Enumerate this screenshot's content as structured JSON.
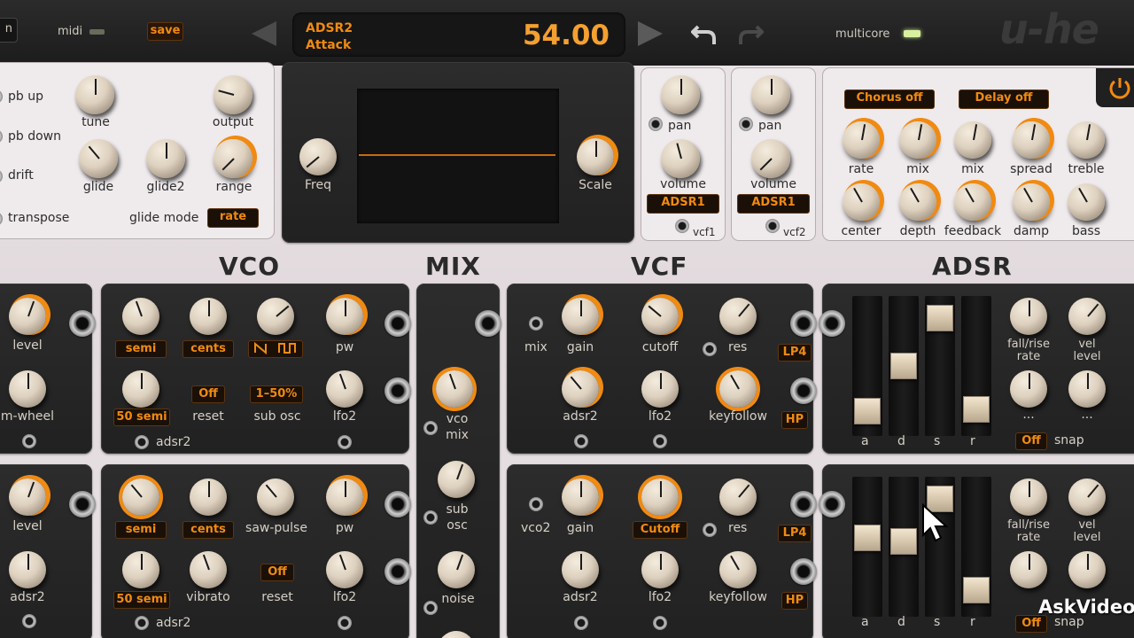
{
  "header": {
    "left_btn": "n",
    "midi": "midi",
    "save": "save",
    "param_name": "ADSR2",
    "param_sub": "Attack",
    "value": "54.00",
    "multicore": "multicore",
    "logo": "u-he",
    "prev_icon": "triangle-left",
    "next_icon": "triangle-right",
    "undo_icon": "undo-arrow",
    "redo_icon": "redo-arrow"
  },
  "colors": {
    "accent": "#f08a12",
    "panel": "#262626",
    "light_panel": "#efeaec",
    "led_green": "#d9f0a0"
  },
  "global": {
    "pb_up": "pb up",
    "pb_down": "pb down",
    "drift": "drift",
    "transpose": "transpose",
    "tune": "tune",
    "output": "output",
    "glide": "glide",
    "glide2": "glide2",
    "range": "range",
    "glide_mode": "glide mode",
    "glide_mode_value": "rate"
  },
  "scope": {
    "freq": "Freq",
    "scale": "Scale"
  },
  "ch1": {
    "pan": "pan",
    "volume": "volume",
    "mod": "ADSR1",
    "vcf": "vcf1"
  },
  "ch2": {
    "pan": "pan",
    "volume": "volume",
    "mod": "ADSR1",
    "vcf": "vcf2"
  },
  "fx": {
    "chorus": "Chorus off",
    "delay": "Delay off",
    "row1": [
      "rate",
      "mix",
      "mix",
      "spread",
      "treble"
    ],
    "row2": [
      "center",
      "depth",
      "feedback",
      "damp",
      "bass"
    ]
  },
  "sections": {
    "vco": "VCO",
    "mix": "MIX",
    "vcf": "VCF",
    "adsr": "ADSR"
  },
  "lfo1": {
    "level": "level",
    "mwheel": "m-wheel"
  },
  "lfo2": {
    "level": "level",
    "adsr2": "adsr2"
  },
  "vco1": {
    "semi": "semi",
    "cents": "cents",
    "wave": "wave-select",
    "pw": "pw",
    "semi_val": "50 semi",
    "reset_val": "Off",
    "reset": "reset",
    "sub_val": "1–50%",
    "sub": "sub osc",
    "lfo2": "lfo2",
    "adsr2": "adsr2"
  },
  "vco2": {
    "semi": "semi",
    "cents": "cents",
    "sawpulse": "saw-pulse",
    "pw": "pw",
    "semi_val": "50 semi",
    "vibrato": "vibrato",
    "reset_val": "Off",
    "reset": "reset",
    "lfo2": "lfo2",
    "adsr2": "adsr2"
  },
  "mix": {
    "vco_mix": "vco mix",
    "sub_osc": "sub osc",
    "noise": "noise"
  },
  "vcf1": {
    "mix": "mix",
    "gain": "gain",
    "cutoff": "cutoff",
    "res": "res",
    "lp": "LP4",
    "adsr2": "adsr2",
    "lfo2": "lfo2",
    "keyfollow": "keyfollow",
    "hp": "HP"
  },
  "vcf2": {
    "vco2": "vco2",
    "gain": "gain",
    "cutoff": "Cutoff",
    "res": "res",
    "lp": "LP4",
    "adsr2": "adsr2",
    "lfo2": "lfo2",
    "keyfollow": "keyfollow",
    "hp": "HP"
  },
  "adsr1": {
    "labels": [
      "a",
      "d",
      "s",
      "r"
    ],
    "levels": [
      0.1,
      0.5,
      0.92,
      0.12
    ],
    "fall": "fall/rise rate",
    "vel": "vel level",
    "dots1": "...",
    "dots2": "...",
    "snap_val": "Off",
    "snap": "snap"
  },
  "adsr2": {
    "labels": [
      "a",
      "d",
      "s",
      "r"
    ],
    "levels": [
      0.58,
      0.55,
      0.92,
      0.12
    ],
    "fall": "fall/rise rate",
    "vel": "vel level",
    "snap_val": "Off",
    "snap": "snap"
  },
  "watermark": "AskVideo"
}
